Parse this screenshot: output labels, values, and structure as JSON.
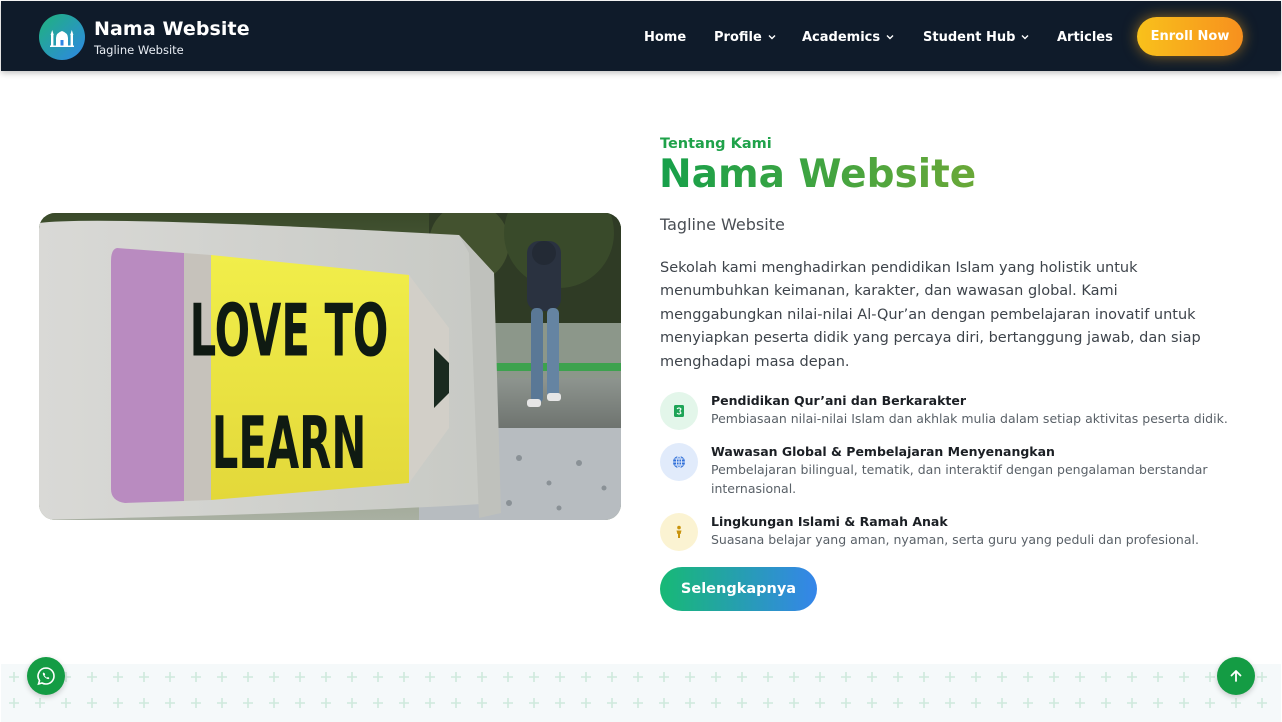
{
  "header": {
    "brand_title": "Nama Website",
    "brand_tagline": "Tagline Website",
    "logo_icon": "mosque-icon",
    "nav": [
      {
        "label": "Home",
        "has_dropdown": false
      },
      {
        "label": "Profile",
        "has_dropdown": true
      },
      {
        "label": "Academics",
        "has_dropdown": true
      },
      {
        "label": "Student Hub",
        "has_dropdown": true
      },
      {
        "label": "Articles",
        "has_dropdown": false
      }
    ],
    "enroll_label": "Enroll Now"
  },
  "about": {
    "image_text": [
      "LOVE TO",
      "LEARN"
    ],
    "eyebrow": "Tentang Kami",
    "headline": "Nama Website",
    "subtitle": "Tagline Website",
    "description": "Sekolah kami menghadirkan pendidikan Islam yang holistik untuk menumbuhkan keimanan, karakter, dan wawasan global. Kami menggabungkan nilai-nilai Al-Qur’an dengan pembelajaran inovatif untuk menyiapkan peserta didik yang percaya diri, bertanggung jawab, dan siap menghadapi masa depan.",
    "features": [
      {
        "icon": "quran-icon",
        "title": "Pendidikan Qur’ani dan Berkarakter",
        "desc": "Pembiasaan nilai-nilai Islam dan akhlak mulia dalam setiap aktivitas peserta didik."
      },
      {
        "icon": "globe-icon",
        "title": "Wawasan Global & Pembelajaran Menyenangkan",
        "desc": "Pembelajaran bilingual, tematik, dan interaktif dengan pengalaman berstandar internasional."
      },
      {
        "icon": "child-icon",
        "title": "Lingkungan Islami & Ramah Anak",
        "desc": "Suasana belajar yang aman, nyaman, serta guru yang peduli dan profesional."
      }
    ],
    "cta_label": "Selengkapnya"
  },
  "floating": {
    "whatsapp_icon": "whatsapp-icon",
    "back_to_top_icon": "arrow-up-icon"
  },
  "colors": {
    "nav_bg": "#0f1b2a",
    "accent_green": "#16a04a",
    "accent_blue": "#3585ea",
    "enroll_orange": "#f7901e",
    "fab_green": "#149c44"
  }
}
